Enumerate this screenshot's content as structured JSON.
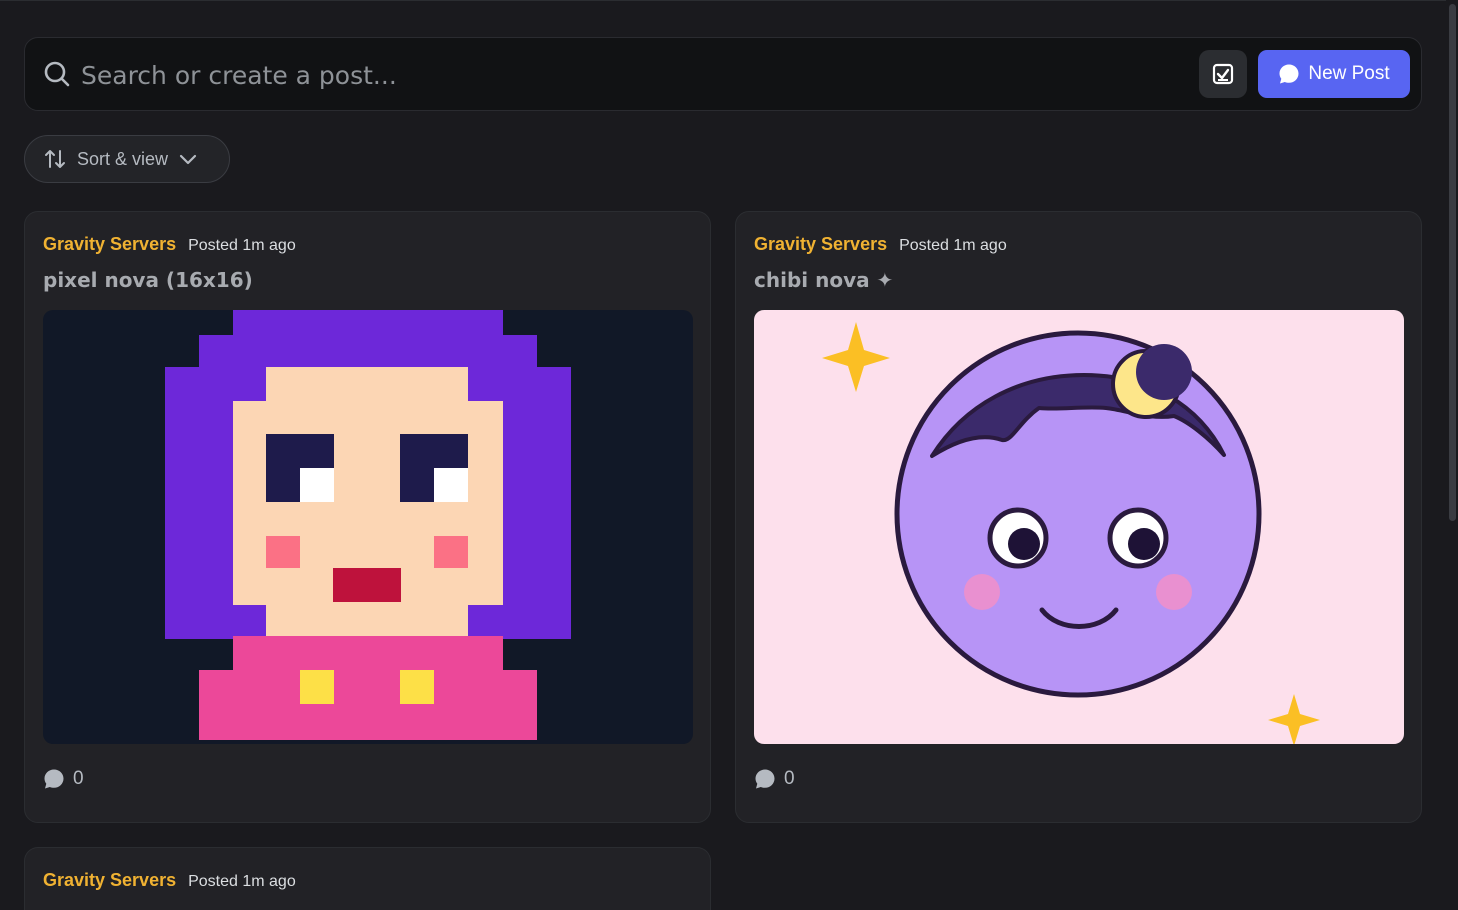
{
  "search": {
    "placeholder": "Search or create a post..."
  },
  "toolbar": {
    "new_post_label": "New Post",
    "check_icon": "checkbox-icon"
  },
  "sort": {
    "label": "Sort & view"
  },
  "posts": [
    {
      "author": "Gravity Servers",
      "posted": "Posted 1m ago",
      "title": "pixel nova (16x16)",
      "comments": "0",
      "image": "pixel-art-portrait"
    },
    {
      "author": "Gravity Servers",
      "posted": "Posted 1m ago",
      "title": "chibi nova ✦",
      "comments": "0",
      "image": "chibi-moon-face"
    },
    {
      "author": "Gravity Servers",
      "posted": "Posted 1m ago"
    }
  ],
  "colors": {
    "accent": "#5865f2",
    "author": "#f0b232",
    "background": "#1a1a1e",
    "card": "#222226"
  }
}
